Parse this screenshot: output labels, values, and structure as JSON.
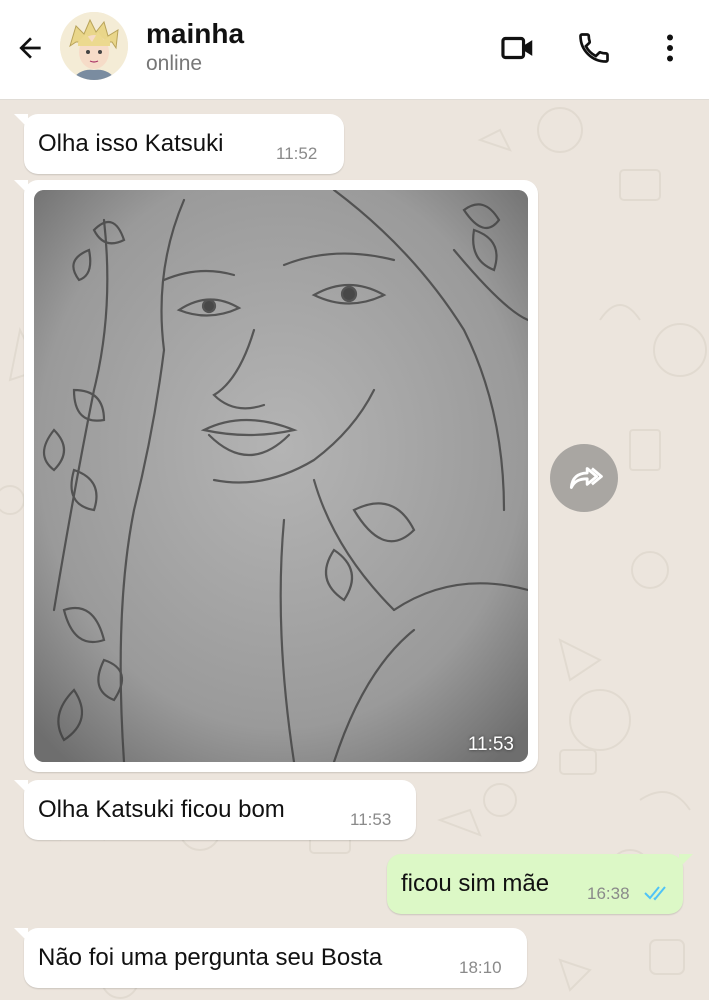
{
  "header": {
    "contact_name": "mainha",
    "status": "online"
  },
  "messages": [
    {
      "direction": "incoming",
      "text": "Olha isso Katsuki",
      "time": "11:52"
    },
    {
      "direction": "incoming",
      "type": "image",
      "time": "11:53"
    },
    {
      "direction": "incoming",
      "text": "Olha Katsuki ficou bom",
      "time": "11:53"
    },
    {
      "direction": "outgoing",
      "text": "ficou sim mãe",
      "time": "16:38",
      "ticks": "read"
    },
    {
      "direction": "incoming",
      "text": "Não foi uma pergunta seu Bosta",
      "time": "18:10"
    }
  ],
  "icons": {
    "back": "arrow-left-icon",
    "video_call": "video-camera-icon",
    "voice_call": "phone-icon",
    "menu": "more-vertical-icon",
    "forward": "forward-icon",
    "read_receipt": "double-check-icon"
  },
  "colors": {
    "incoming_bubble": "#ffffff",
    "outgoing_bubble": "#dcf8c6",
    "wallpaper": "#ece5dd",
    "read_tick": "#4fc3f7"
  }
}
